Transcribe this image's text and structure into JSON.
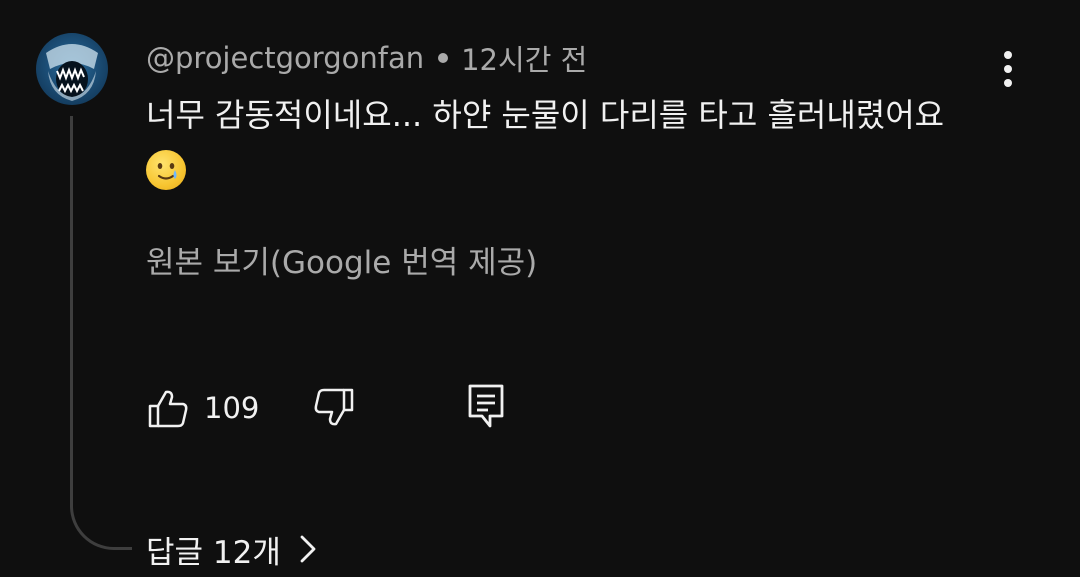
{
  "comment": {
    "author": "@projectgorgonfan",
    "time_ago": "12시간 전",
    "text": "너무 감동적이네요... 하얀 눈물이 다리를 타고 흘러내렸어요",
    "emoji_icon": "smiling-face-with-tear-icon",
    "translate_label": "원본 보기(Google 번역 제공)",
    "like_count": "109",
    "replies_label": "답글 12개"
  },
  "icons": {
    "menu": "more-vert-icon",
    "like": "thumb-up-icon",
    "dislike": "thumb-down-icon",
    "reply": "reply-comment-icon",
    "expand": "chevron-right-icon",
    "avatar": "shark-avatar"
  },
  "colors": {
    "background": "#0f0f0f",
    "primary_text": "#f1f1f1",
    "secondary_text": "#aaaaaa",
    "thread_line": "#3e3e3e"
  }
}
